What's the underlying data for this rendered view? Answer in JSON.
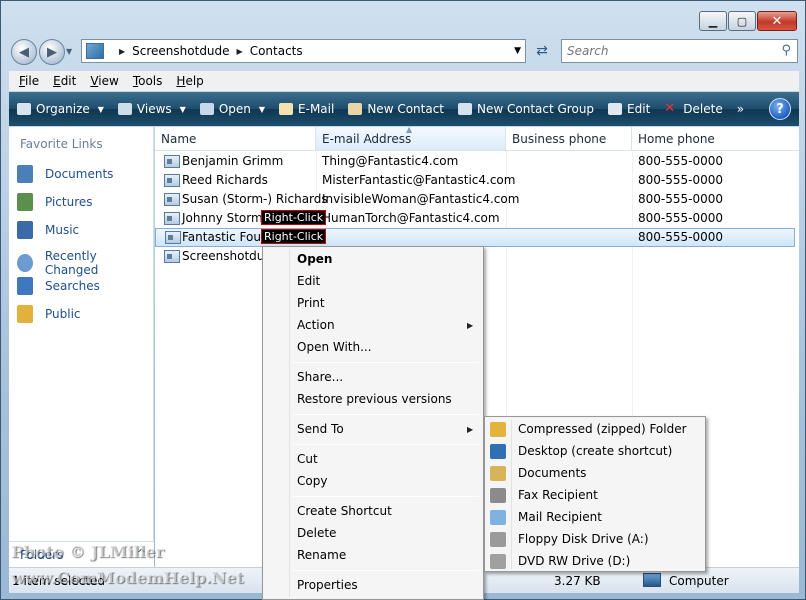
{
  "window": {
    "controls": {
      "minimize": "▁",
      "maximize": "▢",
      "close": "✕"
    }
  },
  "address": {
    "crumbs": [
      "Screenshotdude",
      "Contacts"
    ],
    "search_placeholder": "Search"
  },
  "menubar": [
    "File",
    "Edit",
    "View",
    "Tools",
    "Help"
  ],
  "toolbar": {
    "items": [
      {
        "label": "Organize",
        "icon": "organize-icon",
        "has_arrow": true
      },
      {
        "label": "Views",
        "icon": "views-icon",
        "has_arrow": true
      },
      {
        "label": "Open",
        "icon": "open-icon",
        "has_arrow": true
      },
      {
        "label": "E-Mail",
        "icon": "email-icon",
        "has_arrow": false
      },
      {
        "label": "New Contact",
        "icon": "new-contact-icon",
        "has_arrow": false
      },
      {
        "label": "New Contact Group",
        "icon": "new-contact-group-icon",
        "has_arrow": false
      },
      {
        "label": "Edit",
        "icon": "edit-icon",
        "has_arrow": false
      },
      {
        "label": "Delete",
        "icon": "delete-icon",
        "has_arrow": false
      }
    ],
    "overflow": "»",
    "help": "?"
  },
  "left_pane": {
    "title": "Favorite Links",
    "items": [
      {
        "label": "Documents",
        "icon": "documents-icon",
        "color": "#4a7fb8"
      },
      {
        "label": "Pictures",
        "icon": "pictures-icon",
        "color": "#5b8f4c"
      },
      {
        "label": "Music",
        "icon": "music-icon",
        "color": "#3a6aa8"
      },
      {
        "label": "Recently Changed",
        "icon": "recently-changed-icon",
        "color": "#6d9ad0"
      },
      {
        "label": "Searches",
        "icon": "searches-icon",
        "color": "#3d78c0"
      },
      {
        "label": "Public",
        "icon": "public-icon",
        "color": "#e2b13c"
      }
    ],
    "folders_label": "Folders",
    "folders_chevron": "^"
  },
  "file_list": {
    "columns": [
      "Name",
      "E-mail Address",
      "Business phone",
      "Home phone"
    ],
    "rows": [
      {
        "name": "Benjamin Grimm",
        "email": "Thing@Fantastic4.com",
        "business": "",
        "home": "800-555-0000",
        "tag": ""
      },
      {
        "name": "Reed Richards",
        "email": "MisterFantastic@Fantastic4.com",
        "business": "",
        "home": "800-555-0000",
        "tag": ""
      },
      {
        "name": "Susan (Storm-) Richards",
        "email": "InvisibleWoman@Fantastic4.com",
        "business": "",
        "home": "800-555-0000",
        "tag": ""
      },
      {
        "name": "Johnny Storm",
        "email": "HumanTorch@Fantastic4.com",
        "business": "",
        "home": "800-555-0000",
        "tag": "Right-Click"
      },
      {
        "name": "Fantastic Four",
        "email": "",
        "business": "",
        "home": "800-555-0000",
        "tag": "Right-Click"
      },
      {
        "name": "Screenshotdud",
        "email": "",
        "business": "",
        "home": "",
        "tag": ""
      }
    ]
  },
  "context_menu": {
    "items": [
      {
        "label": "Open",
        "bold": true
      },
      {
        "label": "Edit"
      },
      {
        "label": "Print"
      },
      {
        "label": "Action",
        "submenu": true
      },
      {
        "label": "Open With..."
      },
      {
        "separator": true
      },
      {
        "label": "Share..."
      },
      {
        "label": "Restore previous versions"
      },
      {
        "separator": true
      },
      {
        "label": "Send To",
        "submenu": true
      },
      {
        "separator": true
      },
      {
        "label": "Cut"
      },
      {
        "label": "Copy"
      },
      {
        "separator": true
      },
      {
        "label": "Create Shortcut"
      },
      {
        "label": "Delete"
      },
      {
        "label": "Rename"
      },
      {
        "separator": true
      },
      {
        "label": "Properties"
      }
    ]
  },
  "send_to_menu": {
    "items": [
      {
        "label": "Compressed (zipped) Folder",
        "icon": "zip-folder-icon",
        "color": "#e3b43b"
      },
      {
        "label": "Desktop (create shortcut)",
        "icon": "desktop-icon",
        "color": "#2f6fb3"
      },
      {
        "label": "Documents",
        "icon": "documents-icon",
        "color": "#d9b35a"
      },
      {
        "label": "Fax Recipient",
        "icon": "fax-icon",
        "color": "#8b8b8b"
      },
      {
        "label": "Mail Recipient",
        "icon": "mail-icon",
        "color": "#7fb2de"
      },
      {
        "label": "Floppy Disk Drive (A:)",
        "icon": "floppy-icon",
        "color": "#9a9a9a"
      },
      {
        "label": "DVD RW Drive (D:)",
        "icon": "dvd-drive-icon",
        "color": "#a0a0a0"
      }
    ]
  },
  "status_bar": {
    "selected": "1 item selected",
    "size": "3.27 KB",
    "location": "Computer"
  },
  "watermark": {
    "line1": "Photo © JLMiller",
    "line2": "www.ComModemHelp.Net"
  }
}
